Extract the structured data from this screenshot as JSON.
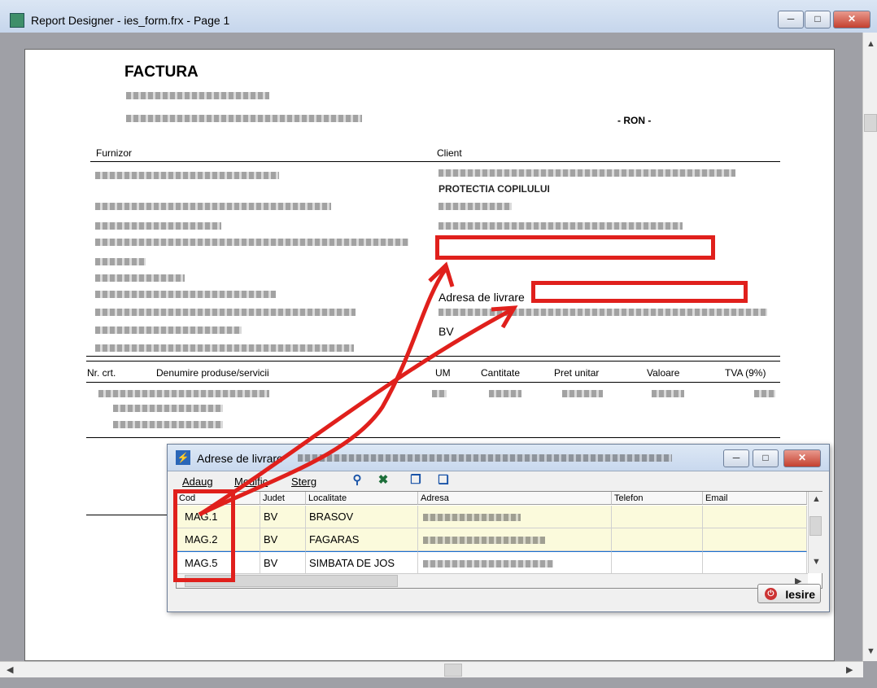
{
  "window": {
    "title": "Report Designer - ies_form.frx - Page 1",
    "minimize": "─",
    "maximize": "□",
    "close": "✕"
  },
  "report": {
    "title": "FACTURA",
    "currency": "- RON -",
    "supplier_label": "Furnizor",
    "client_label": "Client",
    "client_bold_line": "PROTECTIA COPILULUI",
    "delivery_label": "Adresa de livrare",
    "delivery_county": "BV",
    "columns": [
      "Nr. crt.",
      "Denumire produse/servicii",
      "UM",
      "Cantitate",
      "Pret unitar",
      "Valoare",
      "TVA (9%)"
    ]
  },
  "dialog": {
    "title": "Adrese de livrare",
    "menu": [
      "Adaug",
      "Modific",
      "Sterg"
    ],
    "toolbar_icons": [
      "binoculars-icon",
      "excel-icon",
      "copy-icon",
      "paste-icon"
    ],
    "columns": [
      "Cod",
      "Judet",
      "Localitate",
      "Adresa",
      "Telefon",
      "Email"
    ],
    "rows": [
      {
        "cod": "MAG.1",
        "judet": "BV",
        "localitate": "BRASOV"
      },
      {
        "cod": "MAG.2",
        "judet": "BV",
        "localitate": "FAGARAS"
      },
      {
        "cod": "MAG.5",
        "judet": "BV",
        "localitate": "SIMBATA DE JOS"
      }
    ],
    "exit_label": "Iesire",
    "minimize": "─",
    "maximize": "□",
    "close": "✕"
  },
  "colors": {
    "annotation_red": "#e0201c",
    "row_highlight": "#fbfadc",
    "selection_border": "#1a6fd0"
  }
}
